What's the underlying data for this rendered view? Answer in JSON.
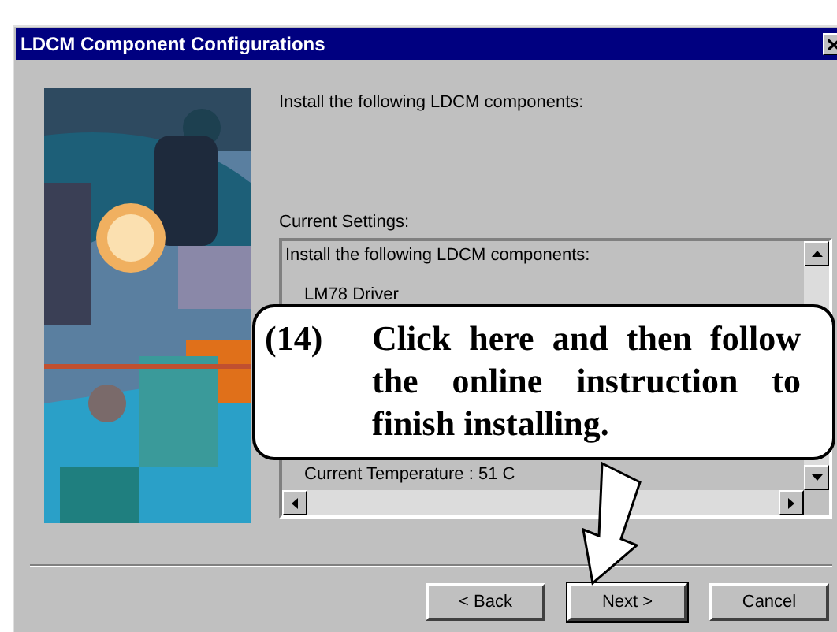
{
  "window": {
    "title": "LDCM Component Configurations"
  },
  "intro": "Install the following LDCM components:",
  "settings": {
    "label": "Current Settings:",
    "lines": [
      "Install the following LDCM components:",
      "LM78 Driver",
      "Current Temperature : 51 C"
    ]
  },
  "buttons": [
    {
      "label": "< Back",
      "default": false
    },
    {
      "label": "Next >",
      "default": true
    },
    {
      "label": "Cancel",
      "default": false
    }
  ],
  "callout": {
    "number": "(14)",
    "text": "Click here and then follow the online instruction to finish installing."
  }
}
